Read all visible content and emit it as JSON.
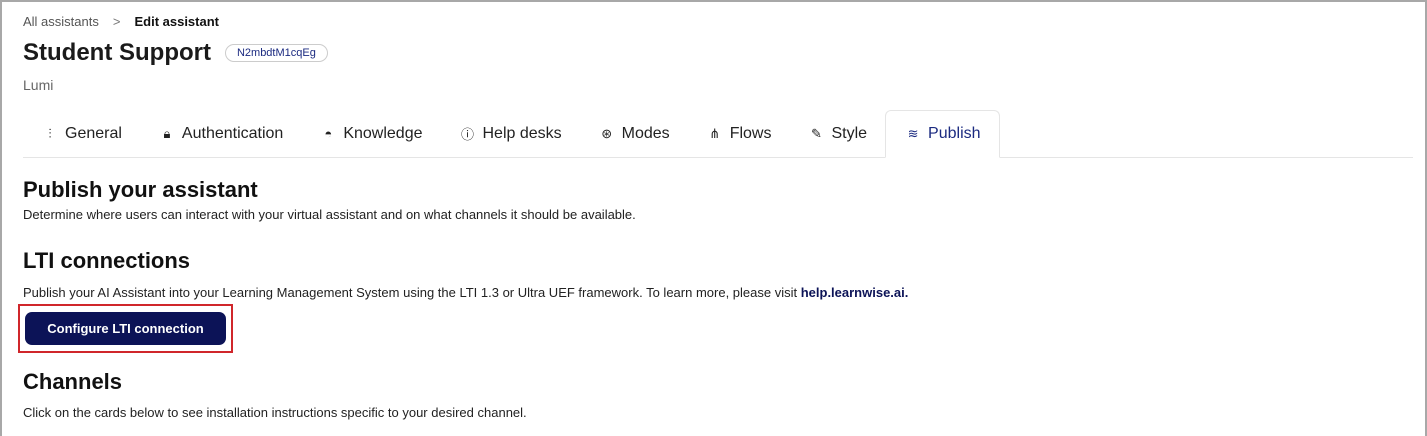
{
  "breadcrumb": {
    "parent": "All assistants",
    "separator": ">",
    "current": "Edit assistant"
  },
  "header": {
    "title": "Student Support",
    "id_badge": "N2mbdtM1cqEg",
    "subtitle": "Lumi"
  },
  "tabs": [
    {
      "label": "General",
      "icon": "sliders-icon"
    },
    {
      "label": "Authentication",
      "icon": "lock-icon"
    },
    {
      "label": "Knowledge",
      "icon": "graduation-cap-icon"
    },
    {
      "label": "Help desks",
      "icon": "question-circle-icon"
    },
    {
      "label": "Modes",
      "icon": "circles-icon"
    },
    {
      "label": "Flows",
      "icon": "flow-icon"
    },
    {
      "label": "Style",
      "icon": "brush-icon"
    },
    {
      "label": "Publish",
      "icon": "layers-icon",
      "active": true
    }
  ],
  "publish": {
    "heading": "Publish your assistant",
    "description": "Determine where users can interact with your virtual assistant and on what channels it should be available."
  },
  "lti": {
    "heading": "LTI connections",
    "description": "Publish your AI Assistant into your Learning Management System using the LTI 1.3 or Ultra UEF framework. To learn more, please visit ",
    "link": "help.learnwise.ai.",
    "button": "Configure LTI connection"
  },
  "channels": {
    "heading": "Channels",
    "description": "Click on the cards below to see installation instructions specific to your desired channel."
  },
  "colors": {
    "primary": "#0c1357",
    "highlight": "#d0262b",
    "active_tab": "#1b2a80"
  }
}
